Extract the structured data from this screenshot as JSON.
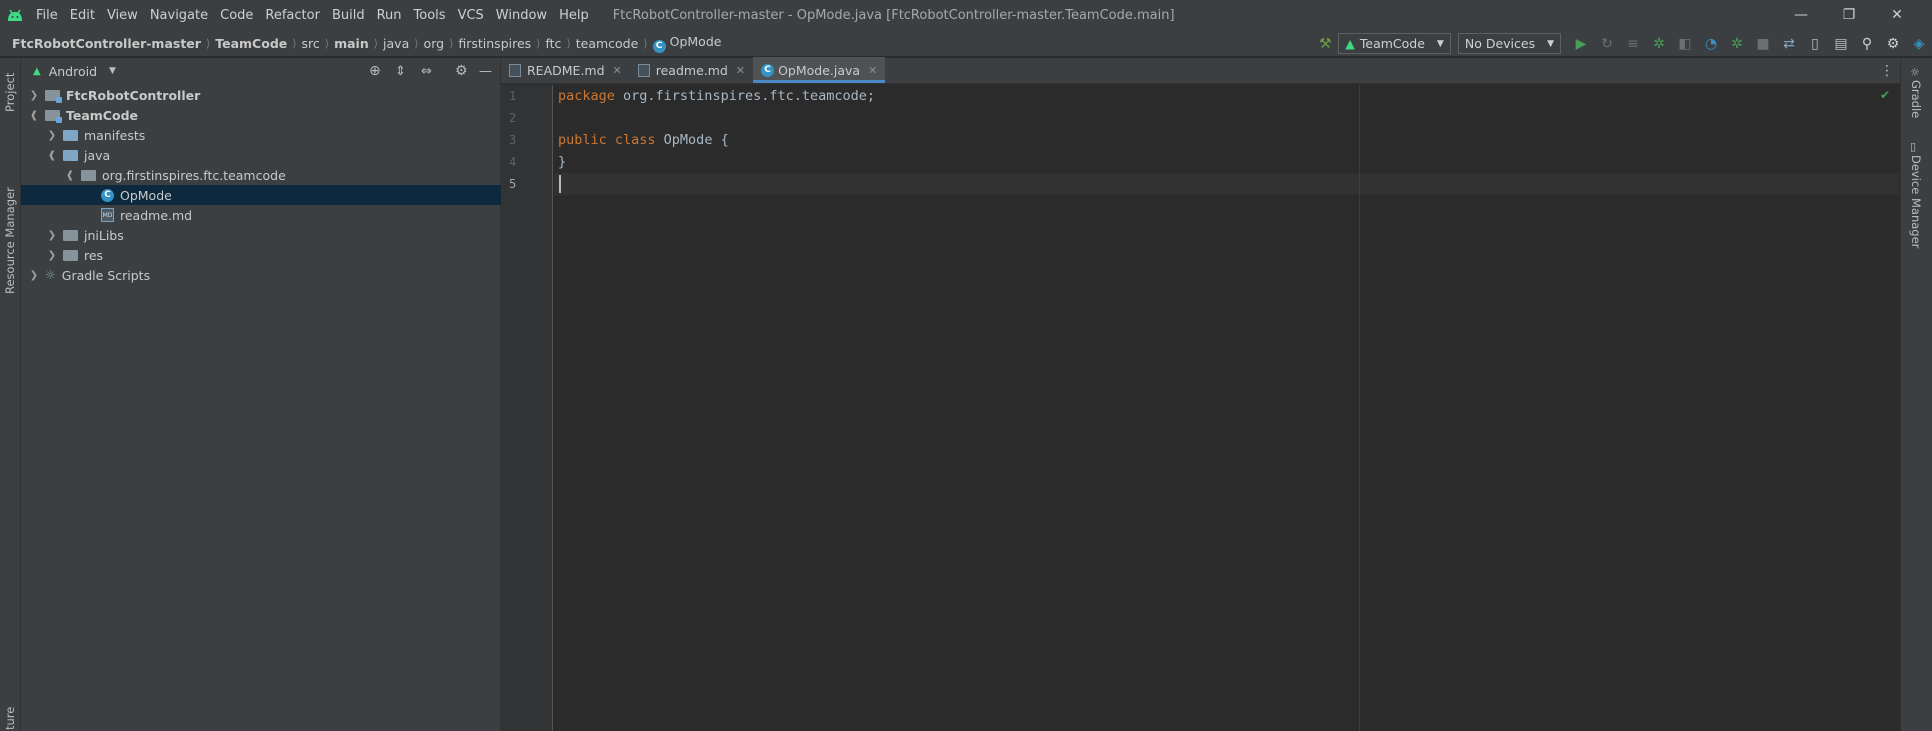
{
  "window": {
    "title": "FtcRobotController-master - OpMode.java [FtcRobotController-master.TeamCode.main]"
  },
  "menu": [
    "File",
    "Edit",
    "View",
    "Navigate",
    "Code",
    "Refactor",
    "Build",
    "Run",
    "Tools",
    "VCS",
    "Window",
    "Help"
  ],
  "breadcrumb": [
    "FtcRobotController-master",
    "TeamCode",
    "src",
    "main",
    "java",
    "org",
    "firstinspires",
    "ftc",
    "teamcode",
    "OpMode"
  ],
  "toolbar": {
    "run_config": "TeamCode",
    "device": "No Devices"
  },
  "left_strip": {
    "project_label": "Project",
    "resource_manager_label": "Resource Manager",
    "structure_label": "ture"
  },
  "project_panel": {
    "view_mode": "Android",
    "tree": [
      {
        "label": "FtcRobotController",
        "level": 0,
        "expanded": false,
        "icon": "module-folder-icon",
        "bold": true
      },
      {
        "label": "TeamCode",
        "level": 0,
        "expanded": true,
        "icon": "module-folder-icon",
        "bold": true
      },
      {
        "label": "manifests",
        "level": 1,
        "expanded": false,
        "icon": "folder-icon",
        "bold": false
      },
      {
        "label": "java",
        "level": 1,
        "expanded": true,
        "icon": "source-folder-icon",
        "bold": false
      },
      {
        "label": "org.firstinspires.ftc.teamcode",
        "level": 2,
        "expanded": true,
        "icon": "package-icon",
        "bold": false
      },
      {
        "label": "OpMode",
        "level": 3,
        "expanded": null,
        "icon": "class-icon",
        "bold": false,
        "selected": true
      },
      {
        "label": "readme.md",
        "level": 3,
        "expanded": null,
        "icon": "markdown-file-icon",
        "bold": false
      },
      {
        "label": "jniLibs",
        "level": 1,
        "expanded": false,
        "icon": "folder-icon",
        "bold": false
      },
      {
        "label": "res",
        "level": 1,
        "expanded": false,
        "icon": "folder-icon",
        "bold": false
      },
      {
        "label": "Gradle Scripts",
        "level": 0,
        "expanded": false,
        "icon": "gradle-icon",
        "bold": false
      }
    ]
  },
  "editor": {
    "tabs": [
      {
        "label": "README.md",
        "active": false
      },
      {
        "label": "readme.md",
        "active": false
      },
      {
        "label": "OpMode.java",
        "active": true
      }
    ],
    "line_numbers": [
      "1",
      "2",
      "3",
      "4",
      "5"
    ],
    "lines": [
      {
        "kw": "package",
        "rest": " org.firstinspires.ftc.teamcode;"
      },
      {
        "kw": "",
        "rest": ""
      },
      {
        "kw": "public class",
        "rest": " OpMode {"
      },
      {
        "kw": "",
        "rest": "}"
      },
      {
        "kw": "",
        "rest": ""
      }
    ]
  },
  "right_strip": {
    "gradle_label": "Gradle",
    "device_manager_label": "Device Manager"
  },
  "colors": {
    "keyword": "#cc7832",
    "code_text": "#a9b7c6",
    "selection": "#0d293e",
    "accent": "#4a88c7"
  }
}
